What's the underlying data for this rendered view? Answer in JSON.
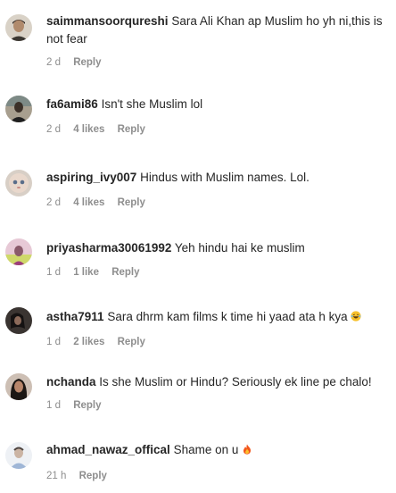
{
  "comments": [
    {
      "username": "saimmansoorqureshi",
      "text": "Sara Ali Khan ap Muslim ho yh ni,this is not fear",
      "time": "2 d",
      "likes": "",
      "reply_label": "Reply",
      "avatar_icon": "user-avatar-dark-hair-icon"
    },
    {
      "username": "fa6ami86",
      "text": "Isn't she Muslim lol",
      "time": "2 d",
      "likes": "4 likes",
      "reply_label": "Reply",
      "avatar_icon": "user-avatar-person-icon"
    },
    {
      "username": "aspiring_ivy007",
      "text": "Hindus with Muslim names. Lol.",
      "time": "2 d",
      "likes": "4 likes",
      "reply_label": "Reply",
      "avatar_icon": "user-avatar-doll-icon"
    },
    {
      "username": "priyasharma30061992",
      "text": "Yeh hindu hai ke muslim",
      "time": "1 d",
      "likes": "1 like",
      "reply_label": "Reply",
      "avatar_icon": "user-avatar-pink-icon"
    },
    {
      "username": "astha7911",
      "text": "Sara dhrm kam films k time hi yaad ata h kya",
      "emoji": "laughing-face-emoji",
      "time": "1 d",
      "likes": "2 likes",
      "reply_label": "Reply",
      "avatar_icon": "user-avatar-dark-icon"
    },
    {
      "username": "nchanda",
      "text": "Is she Muslim or Hindu? Seriously ek line pe chalo!",
      "time": "1 d",
      "likes": "",
      "reply_label": "Reply",
      "avatar_icon": "user-avatar-woman-icon"
    },
    {
      "username": "ahmad_nawaz_offical",
      "text": "Shame on u",
      "emoji": "fire-emoji",
      "time": "21 h",
      "likes": "",
      "reply_label": "Reply",
      "avatar_icon": "user-avatar-light-icon"
    }
  ],
  "colors": {
    "text": "#262626",
    "meta": "#8e8e8e",
    "background": "#ffffff"
  }
}
